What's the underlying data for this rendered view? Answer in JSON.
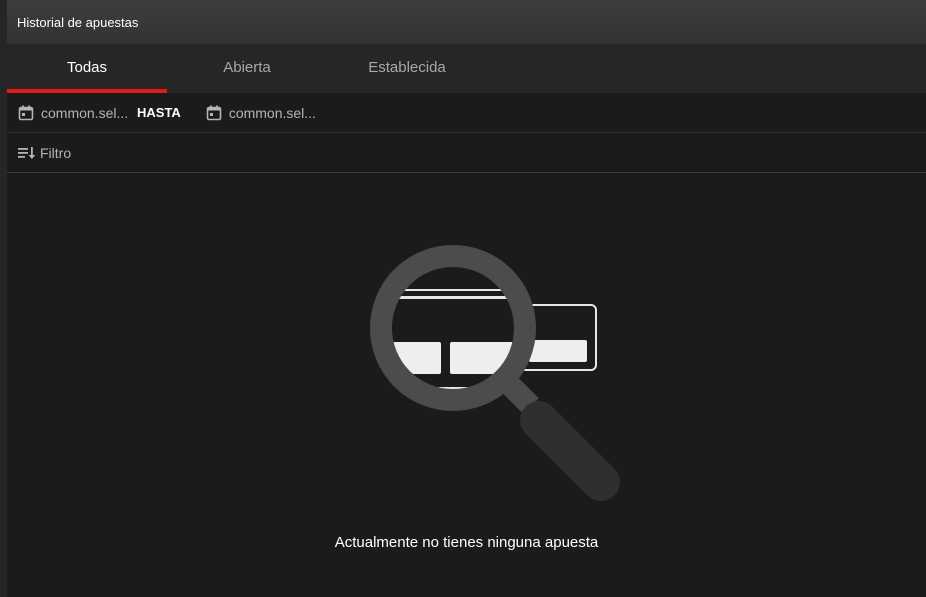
{
  "header": {
    "title": "Historial de apuestas"
  },
  "tabs": [
    {
      "label": "Todas",
      "active": true
    },
    {
      "label": "Abierta",
      "active": false
    },
    {
      "label": "Establecida",
      "active": false
    }
  ],
  "date_range": {
    "from_text": "common.sel...",
    "separator": "HASTA",
    "to_text": "common.sel...",
    "icon": "calendar-icon"
  },
  "filter": {
    "label": "Filtro",
    "icon": "filter-sort-icon"
  },
  "empty_state": {
    "message": "Actualmente no tienes ninguna apuesta",
    "icon": "magnifying-glass-icon"
  },
  "colors": {
    "accent": "#e3191b",
    "background": "#1b1b1b",
    "tab_bar": "#262626"
  }
}
